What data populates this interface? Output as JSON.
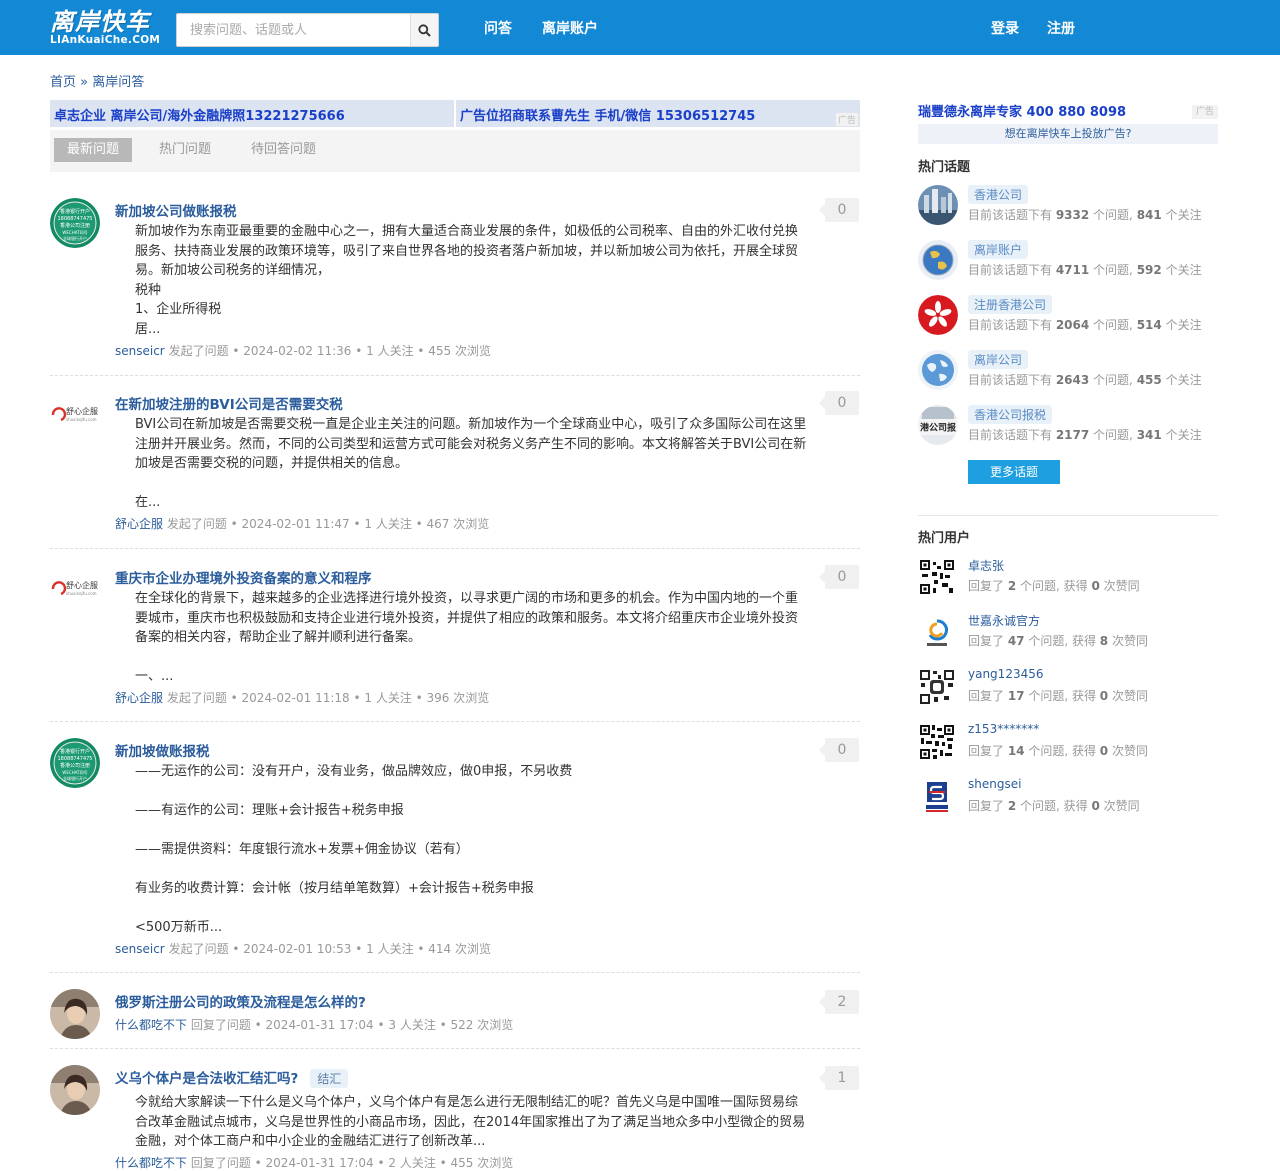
{
  "header": {
    "logo_cn": "离岸快车",
    "logo_en": "LIAnKuaiChe.COM",
    "search_placeholder": "搜索问题、话题或人",
    "nav": [
      "问答",
      "离岸账户"
    ],
    "login": "登录",
    "register": "注册"
  },
  "breadcrumb": "首页 » 离岸问答",
  "ads": [
    "卓志企业 离岸公司/海外金融牌照13221275666",
    "广告位招商联系曹先生 手机/微信 15306512745"
  ],
  "ad_tag": "广告",
  "tabs": [
    "最新问题",
    "热门问题",
    "待回答问题"
  ],
  "questions": [
    {
      "title": "新加坡公司做账报税",
      "body": "新加坡作为东南亚最重要的金融中心之一，拥有大量适合商业发展的条件，如极低的公司税率、自由的外汇收付兑换服务、扶持商业发展的政策环境等，吸引了来自世界各地的投资者落户新加坡，并以新加坡公司为依托，开展全球贸易。新加坡公司税务的详细情况，\n税种\n1、企业所得税\n居...",
      "author": "senseicr",
      "meta": " 发起了问题 • 2024-02-02 11:36 • 1 人关注 • 455 次浏览",
      "count": "0"
    },
    {
      "title": "在新加坡注册的BVI公司是否需要交税",
      "body": "BVI公司在新加坡是否需要交税一直是企业主关注的问题。新加坡作为一个全球商业中心，吸引了众多国际公司在这里注册并开展业务。然而，不同的公司类型和运营方式可能会对税务义务产生不同的影响。本文将解答关于BVI公司在新加坡是否需要交税的问题，并提供相关的信息。\n\n在...",
      "author": "舒心企服",
      "meta": " 发起了问题 • 2024-02-01 11:47 • 1 人关注 • 467 次浏览",
      "count": "0"
    },
    {
      "title": "重庆市企业办理境外投资备案的意义和程序",
      "body": "在全球化的背景下，越来越多的企业选择进行境外投资，以寻求更广阔的市场和更多的机会。作为中国内地的一个重要城市，重庆市也积极鼓励和支持企业进行境外投资，并提供了相应的政策和服务。本文将介绍重庆市企业境外投资备案的相关内容，帮助企业了解并顺利进行备案。\n\n一、...",
      "author": "舒心企服",
      "meta": " 发起了问题 • 2024-02-01 11:18 • 1 人关注 • 396 次浏览",
      "count": "0"
    },
    {
      "title": "新加坡做账报税",
      "body": "——无运作的公司：没有开户，没有业务，做品牌效应，做0申报，不另收费\n\n——有运作的公司：理账+会计报告+税务申报\n\n——需提供资料：年度银行流水+发票+佣金协议（若有）\n\n有业务的收费计算：会计帐（按月结单笔数算）+会计报告+税务申报\n\n<500万新币...",
      "author": "senseicr",
      "meta": " 发起了问题 • 2024-02-01 10:53 • 1 人关注 • 414 次浏览",
      "count": "0"
    },
    {
      "title": "俄罗斯注册公司的政策及流程是怎么样的?",
      "body": "",
      "author": "什么都吃不下",
      "meta": " 回复了问题 • 2024-01-31 17:04 • 3 人关注 • 522 次浏览",
      "count": "2"
    },
    {
      "title": "义乌个体户是合法收汇结汇吗?",
      "tag": "结汇",
      "body": "今就给大家解读一下什么是义乌个体户，义乌个体户有是怎么进行无限制结汇的呢？首先义乌是中国唯一国际贸易综合改革金融试点城市，义乌是世界性的小商品市场，因此，在2014年国家推出了为了满足当地众多中小型微企的贸易金融，对个体工商户和中小企业的金融结汇进行了创新改革...",
      "author": "什么都吃不下",
      "meta": " 回复了问题 • 2024-01-31 17:04 • 2 人关注 • 455 次浏览",
      "count": "1"
    }
  ],
  "avatar_text": {
    "sensei": [
      "香港银行开户",
      "18088747475",
      "香港公司注册",
      "WECHAT同号",
      "全球银行开户"
    ],
    "shuxin_cn": "舒心企服",
    "shuxin_en": "shuxinqifu.com"
  },
  "sidebar": {
    "ad_title": "瑞豐德永离岸专家 400 880 8098",
    "ad_tag": "广告",
    "ad_link": "想在离岸快车上投放广告?",
    "hot_topics_heading": "热门话题",
    "topics": [
      {
        "name": "香港公司",
        "q": "9332",
        "f": "841"
      },
      {
        "name": "离岸账户",
        "q": "4711",
        "f": "592"
      },
      {
        "name": "注册香港公司",
        "q": "2064",
        "f": "514"
      },
      {
        "name": "离岸公司",
        "q": "2643",
        "f": "455"
      },
      {
        "name": "香港公司报税",
        "q": "2177",
        "f": "341",
        "img_text": "港公司报"
      }
    ],
    "topic_info_pre": "目前该话题下有 ",
    "topic_info_mid": " 个问题, ",
    "topic_info_post": " 个关注",
    "more_topics": "更多话题",
    "hot_users_heading": "热门用户",
    "users": [
      {
        "name": "卓志张",
        "a": "2",
        "v": "0"
      },
      {
        "name": "世嘉永诚官方",
        "a": "47",
        "v": "8"
      },
      {
        "name": "yang123456",
        "a": "17",
        "v": "0"
      },
      {
        "name": "z153*******",
        "a": "14",
        "v": "0"
      },
      {
        "name": "shengsei",
        "a": "2",
        "v": "0"
      }
    ],
    "user_info_pre": "回复了 ",
    "user_info_mid": " 个问题, 获得 ",
    "user_info_post": " 次赞同"
  },
  "colors": {
    "header_bg": "#1388d4",
    "link": "#2b5d9c",
    "ad_text": "#1a3fc8",
    "ad_bg": "#dce4f2",
    "button": "#1e9fe0"
  }
}
